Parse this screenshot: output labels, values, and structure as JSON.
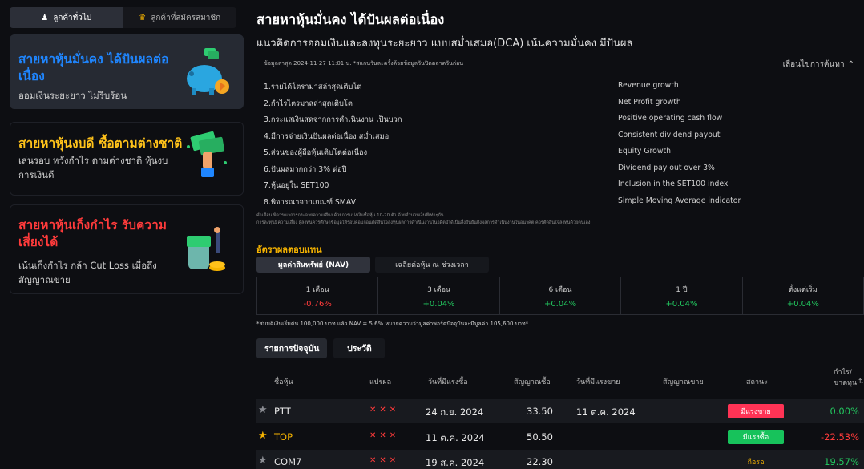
{
  "sidebar": {
    "tabs": [
      {
        "label": "ลูกค้าทั่วไป",
        "icon": "user-icon",
        "active": true
      },
      {
        "label": "ลูกค้าที่สมัครสมาชิก",
        "icon": "crown-icon",
        "active": false
      }
    ],
    "cards": [
      {
        "title": "สายหาหุ้นมั่นคง ได้ปันผลต่อเนื่อง",
        "subtitle": "ออมเงินระยะยาว ไม่รีบร้อน",
        "icon": "piggy-bank-illustration",
        "color": "#1f86ff",
        "active": true
      },
      {
        "title": "สายหาหุ้นงบดี ซื้อตามต่างชาติ",
        "subtitle": "เล่นรอบ หวังกำไร ตามต่างชาติ หุ้นงบการเงินดี",
        "icon": "money-hand-illustration",
        "color": "#ffc21a",
        "active": false
      },
      {
        "title": "สายหาหุ้นเก็งกำไร รับความเสี่ยงได้",
        "subtitle": "เน้นเก็งกำไร กล้า Cut Loss เมื่อถึงสัญญาณขาย",
        "icon": "coin-jar-illustration",
        "color": "#ff3b3b",
        "active": false
      }
    ]
  },
  "main": {
    "title": "สายหาหุ้นมั่นคง ได้ปันผลต่อเนื่อง",
    "subtitle": "แนวคิดการออมเงินและลงทุนระยะยาว แบบสม่ำเสมอ(DCA) เน้นความมั่นคง มีปันผล",
    "updated": "ข้อมูลล่าสุด 2024-11-27 11:01 น. *สแกนวันละครั้งด้วยข้อมูลวันปิดตลาดวันก่อน",
    "hide_conditions": "เลื่อนไขการค้นหา",
    "conditions": [
      {
        "th": "1.รายได้โตรามาสล่าสุดเติบโต",
        "en": "Revenue growth"
      },
      {
        "th": "2.กำไรไตรมาสล่าสุดเติบโต",
        "en": "Net Profit growth"
      },
      {
        "th": "3.กระแสเงินสดจากการดำเนินงาน เป็นบวก",
        "en": "Positive operating cash flow"
      },
      {
        "th": "4.มีการจ่ายเงินปันผลต่อเนื่อง สม่ำเสมอ",
        "en": "Consistent dividend payout"
      },
      {
        "th": "5.ส่วนของผู้ถือหุ้นเติบโตต่อเนื่อง",
        "en": "Equity Growth"
      },
      {
        "th": "6.ปันผลมากกว่า 3% ต่อปี",
        "en": "Dividend pay out over 3%"
      },
      {
        "th": "7.หุ้นอยู่ใน SET100",
        "en": "Inclusion in the SET100 index"
      },
      {
        "th": "8.พิจารณาจากเกณฑ์ SMAV",
        "en": "Simple Moving Average indicator"
      }
    ],
    "disclaimer_1": "คำเตือน พิจารณาการกระจายความเสี่ยง ด้วยการแบ่งเงินซื้อหุ้น 10-20 ตัว ด้วยจำนวนเงินที่เท่าๆกัน",
    "disclaimer_2": "การลงทุนมีความเสี่ยง ผู้ลงทุนควรศึกษาข้อมูลให้รอบคอบก่อนตัดสินใจลงทุนผลการดำเนินงานในอดีตมิได้เป็นสิ่งยืนยันถึงผลการดำเนินงานในอนาคต ควรตัดสินใจลงทุนด้วยตนเอง",
    "returns": {
      "title": "อัตราผลตอบแทน",
      "tabs": [
        "มูลค่าสินทรัพย์ (NAV)",
        "เฉลี่ยต่อหุ้น ณ ช่วงเวลา"
      ],
      "periods": [
        {
          "label": "1 เดือน",
          "value": "-0.76%",
          "tone": "neg"
        },
        {
          "label": "3 เดือน",
          "value": "+0.04%",
          "tone": "pos"
        },
        {
          "label": "6 เดือน",
          "value": "+0.04%",
          "tone": "pos"
        },
        {
          "label": "1 ปี",
          "value": "+0.04%",
          "tone": "pos"
        },
        {
          "label": "ตั้งแต่เริ่ม",
          "value": "+0.04%",
          "tone": "pos"
        }
      ],
      "note": "*สมมติเงินเริ่มต้น 100,000 บาท แล้ว NAV = 5.6% หมายความว่ามูลค่าพอร์ตปัจจุบันจะมีมูลค่า 105,600 บาท*"
    },
    "list_tabs": [
      "รายการปัจจุบัน",
      "ประวัติ"
    ],
    "columns": {
      "name": "ชื่อหุ้น",
      "signal": "แปรผล",
      "buy_date": "วันที่มีแรงซื้อ",
      "buy_signal": "สัญญาณซื้อ",
      "sell_date": "วันที่มีแรงขาย",
      "sell_signal": "สัญญาณขาย",
      "status": "สถานะ",
      "profit": "กำไร/ขาดทุน"
    },
    "stocks": [
      {
        "favorite": false,
        "name": "PTT",
        "signal": "✕✕✕",
        "buy_date": "24 ก.ย. 2024",
        "buy_price": "33.50",
        "sell_date": "11 ต.ค. 2024",
        "sell_price": "",
        "status": "มีแรงขาย",
        "status_type": "sell",
        "profit": "0.00%",
        "profit_tone": "pos"
      },
      {
        "favorite": true,
        "name": "TOP",
        "signal": "✕✕✕",
        "buy_date": "11 ต.ค. 2024",
        "buy_price": "50.50",
        "sell_date": "",
        "sell_price": "",
        "status": "มีแรงซื้อ",
        "status_type": "buy",
        "profit": "-22.53%",
        "profit_tone": "neg"
      },
      {
        "favorite": false,
        "name": "COM7",
        "signal": "✕✕✕",
        "buy_date": "19 ส.ค. 2024",
        "buy_price": "22.30",
        "sell_date": "",
        "sell_price": "",
        "status": "ถือรอ",
        "status_type": "hold",
        "profit": "19.57%",
        "profit_tone": "pos"
      }
    ]
  }
}
